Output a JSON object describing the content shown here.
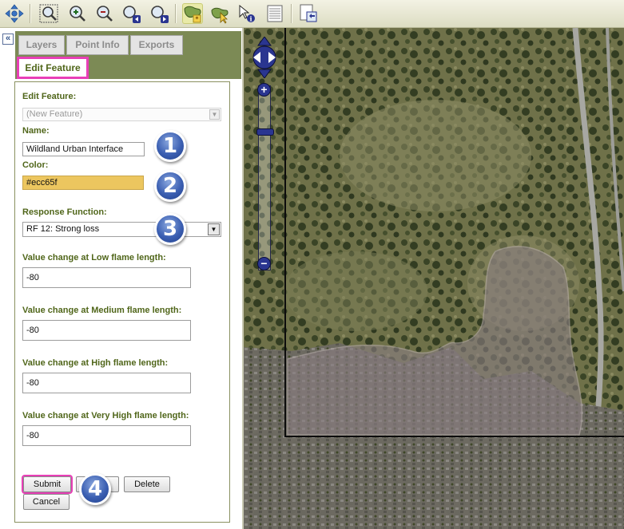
{
  "toolbar": {
    "icons": [
      "pan-arrows-icon",
      "zoom-full-extent-icon",
      "zoom-in-icon",
      "zoom-out-icon",
      "zoom-previous-icon",
      "zoom-next-icon",
      "edit-feature-icon",
      "select-feature-icon",
      "identify-icon",
      "attribute-table-icon",
      "export-map-icon"
    ]
  },
  "panel": {
    "collapse_label": "«",
    "tabs": {
      "layers": "Layers",
      "point_info": "Point Info",
      "exports": "Exports",
      "edit_feature": "Edit Feature"
    },
    "form": {
      "edit_feature_label": "Edit Feature:",
      "edit_feature_value": "(New Feature)",
      "name_label": "Name:",
      "name_value": "Wildland Urban Interface",
      "color_label": "Color:",
      "color_value": "#ecc65f",
      "response_label": "Response Function:",
      "response_value": "RF 12: Strong loss",
      "low_label": "Value change at Low flame length:",
      "low_value": "-80",
      "medium_label": "Value change at Medium flame length:",
      "medium_value": "-80",
      "high_label": "Value change at High flame length:",
      "high_value": "-80",
      "very_high_label": "Value change at Very High flame length:",
      "very_high_value": "-80",
      "submit_label": "Submit",
      "delete_label": "Delete",
      "cancel_label": "Cancel"
    },
    "steps": [
      "1",
      "2",
      "3",
      "4"
    ]
  },
  "map": {
    "zoom_in_label": "+",
    "zoom_out_label": "−"
  },
  "colors": {
    "toolbar_bg": "#e8e7d2",
    "panel_header": "#7c8a55",
    "label_green": "#50661a",
    "highlight_pink": "#e83fb7",
    "color_swatch": "#ecc65f",
    "step_badge": "#3b5fb2",
    "nav_blue": "#2a3590"
  }
}
